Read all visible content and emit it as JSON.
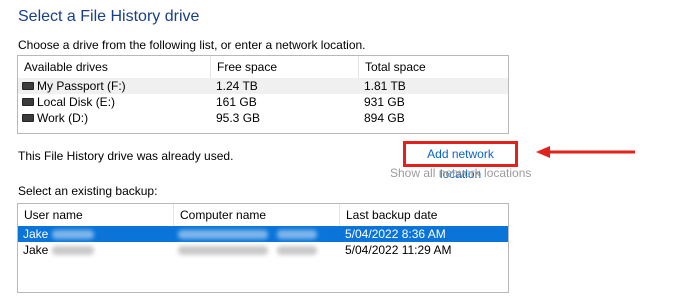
{
  "title": "Select a File History drive",
  "subtitle": "Choose a drive from the following list, or enter a network location.",
  "drives": {
    "headers": [
      "Available drives",
      "Free space",
      "Total space"
    ],
    "rows": [
      {
        "name": "My Passport (F:)",
        "free": "1.24 TB",
        "total": "1.81 TB",
        "icon": "drive-icon"
      },
      {
        "name": "Local Disk (E:)",
        "free": "161 GB",
        "total": "931 GB",
        "icon": "drive-icon"
      },
      {
        "name": "Work (D:)",
        "free": "95.3 GB",
        "total": "894 GB",
        "icon": "drive-icon"
      }
    ]
  },
  "status_text": "This File History drive was already used.",
  "add_network_label": "Add network location",
  "show_all_label": "Show all network locations",
  "select_backup_label": "Select an existing backup:",
  "backups": {
    "headers": [
      "User name",
      "Computer name",
      "Last backup date"
    ],
    "rows": [
      {
        "user": "Jake",
        "date": "5/04/2022 8:36 AM",
        "selected": true
      },
      {
        "user": "Jake",
        "date": "5/04/2022 11:29 AM",
        "selected": false
      }
    ]
  },
  "colors": {
    "title": "#1a3f8a",
    "link": "#0a63c9",
    "highlight_box": "#e1211a",
    "selection": "#0a74d9"
  }
}
